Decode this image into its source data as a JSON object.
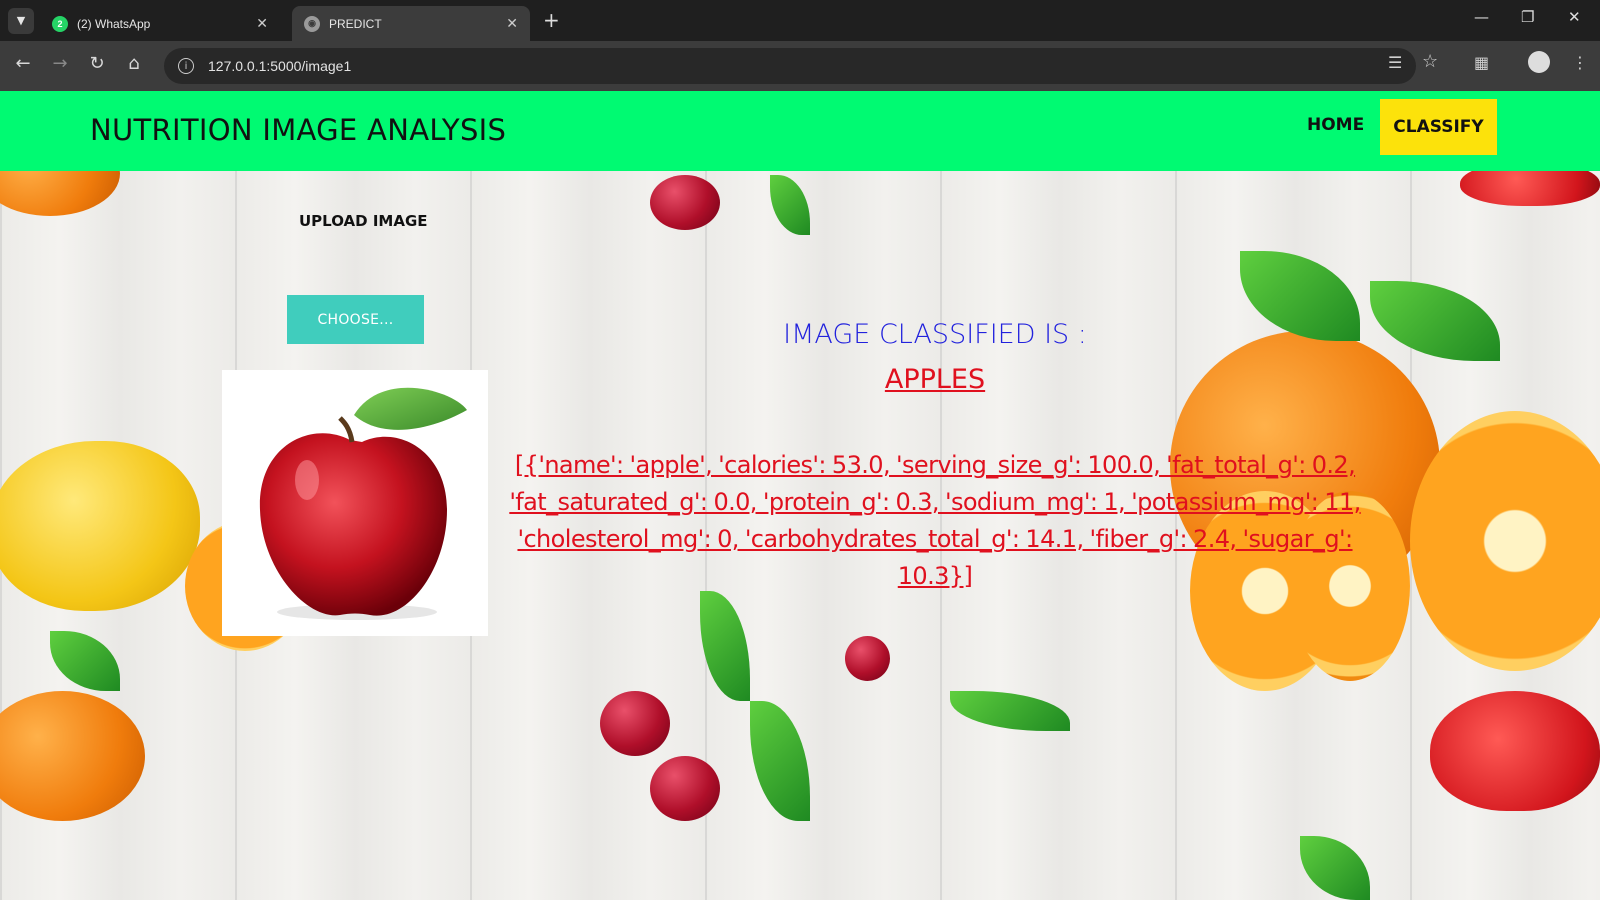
{
  "browser": {
    "tabs": [
      {
        "title": "(2) WhatsApp",
        "favicon": "whatsapp-icon",
        "badge": "2"
      },
      {
        "title": "PREDICT",
        "favicon": "globe-icon"
      }
    ],
    "url": "127.0.0.1:5000/image1"
  },
  "navbar": {
    "brand": "NUTRITION IMAGE ANALYSIS",
    "home": "HOME",
    "classify": "CLASSIFY",
    "bg_color": "#00fa72",
    "active_color": "#fce20b"
  },
  "upload": {
    "label": "UPLOAD IMAGE",
    "button": "CHOOSE..."
  },
  "result": {
    "heading": "IMAGE CLASSIFIED IS :",
    "class_name": "APPLES",
    "nutrition": "[{'name': 'apple', 'calories': 53.0, 'serving_size_g': 100.0, 'fat_total_g': 0.2, 'fat_saturated_g': 0.0, 'protein_g': 0.3, 'sodium_mg': 1, 'potassium_mg': 11, 'cholesterol_mg': 0, 'carbohydrates_total_g': 14.1, 'fiber_g': 2.4, 'sugar_g': 10.3}]"
  }
}
